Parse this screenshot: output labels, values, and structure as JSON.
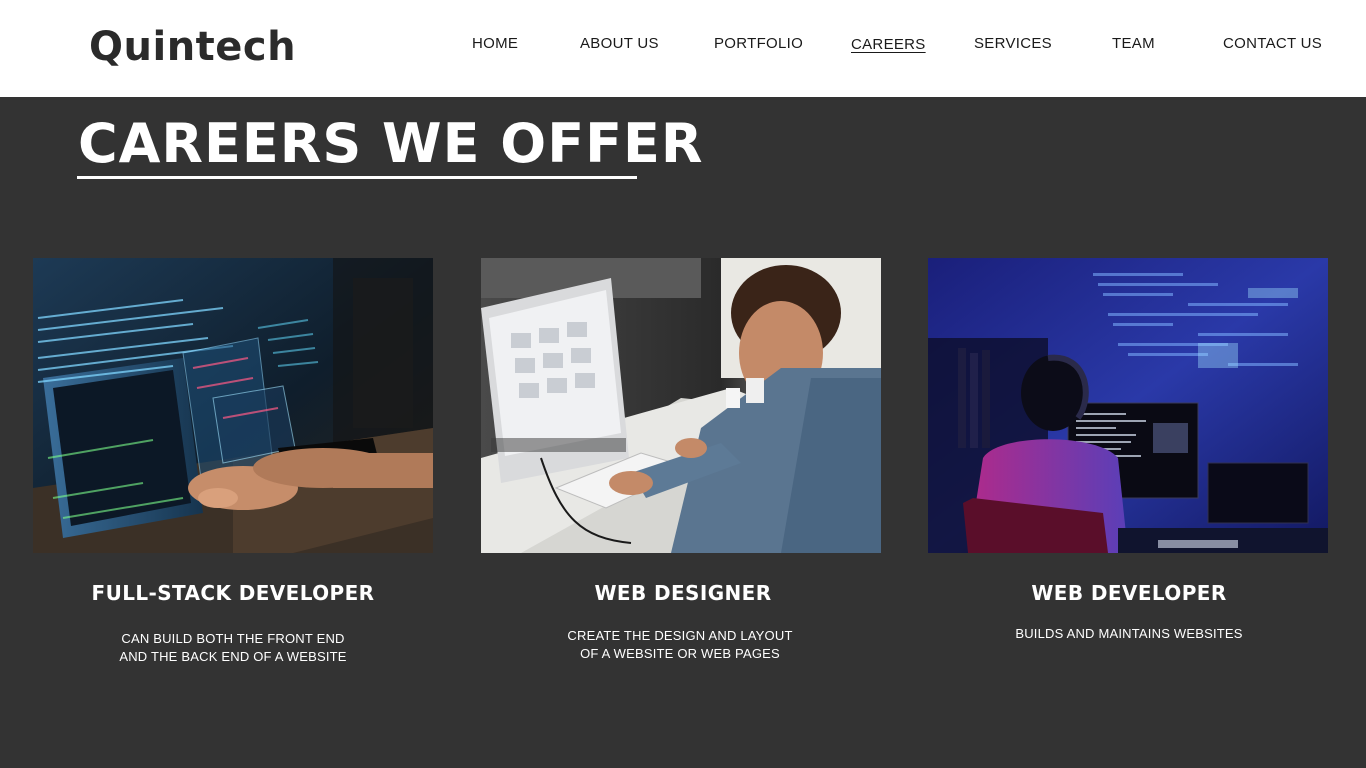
{
  "header": {
    "logo": "Quintech",
    "nav": [
      {
        "label": "HOME"
      },
      {
        "label": "ABOUT US"
      },
      {
        "label": "PORTFOLIO"
      },
      {
        "label": "CAREERS",
        "active": true
      },
      {
        "label": "SERVICES"
      },
      {
        "label": "TEAM"
      },
      {
        "label": "CONTACT US"
      }
    ]
  },
  "main": {
    "title": "CAREERS WE OFFER",
    "cards": [
      {
        "title": "FULL-STACK DEVELOPER",
        "description": [
          "CAN BUILD BOTH THE FRONT END",
          "AND THE BACK END OF A WEBSITE"
        ],
        "image": "developer-typing-code-photo"
      },
      {
        "title": "WEB DESIGNER",
        "description": [
          "CREATE THE DESIGN AND LAYOUT",
          "OF A WEBSITE OR WEB PAGES"
        ],
        "image": "designer-at-desktop-photo"
      },
      {
        "title": "WEB DEVELOPER",
        "description": [
          "BUILDS AND MAINTAINS WEBSITES"
        ],
        "image": "developer-dark-room-photo"
      }
    ]
  },
  "colors": {
    "background": "#333333",
    "header_background": "#ffffff",
    "text_light": "#ffffff",
    "text_dark": "#1a1a1a"
  }
}
